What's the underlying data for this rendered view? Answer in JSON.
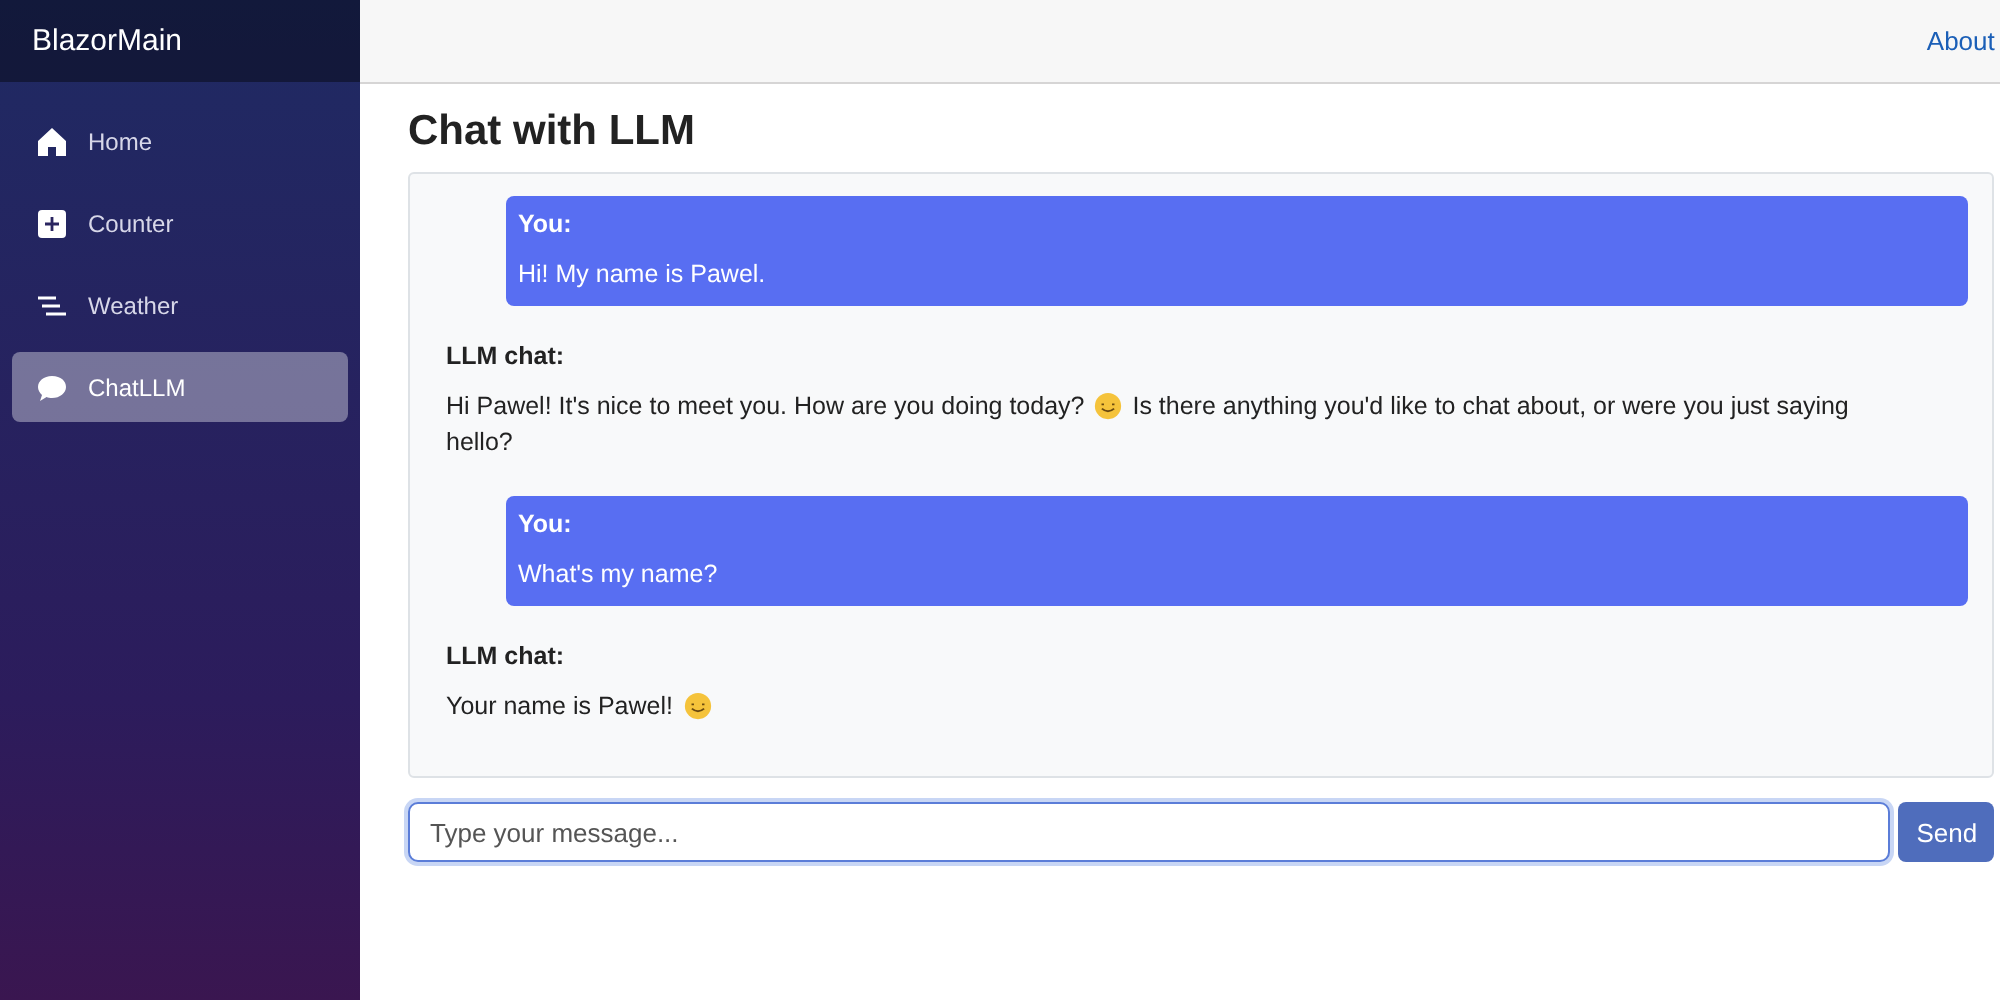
{
  "brand": "BlazorMain",
  "nav": [
    {
      "label": "Home",
      "kind": "home",
      "selected": false
    },
    {
      "label": "Counter",
      "kind": "plus",
      "selected": false
    },
    {
      "label": "Weather",
      "kind": "lines",
      "selected": false
    },
    {
      "label": "ChatLLM",
      "kind": "chat",
      "selected": true
    }
  ],
  "top_bar": {
    "link": "About"
  },
  "title": "Chat with LLM",
  "messages": [
    {
      "kind": "user",
      "sender": "You:",
      "lines": [
        [
          {
            "kind": "text",
            "text": "Hi! My name is Pawel."
          }
        ]
      ]
    },
    {
      "kind": "bot",
      "sender": "LLM chat:",
      "lines": [
        [
          {
            "kind": "text",
            "text": "Hi Pawel! It's nice to meet you. How are you doing today?"
          },
          {
            "kind": "smiley"
          },
          {
            "kind": "text",
            "text": "Is there anything you'd like to chat about, or were you just saying"
          }
        ],
        [
          {
            "kind": "text",
            "text": "hello?"
          }
        ]
      ]
    },
    {
      "kind": "user",
      "sender": "You:",
      "lines": [
        [
          {
            "kind": "text",
            "text": "What's my name?"
          }
        ]
      ]
    },
    {
      "kind": "bot",
      "sender": "LLM chat:",
      "lines": [
        [
          {
            "kind": "text",
            "text": "Your name is Pawel!"
          },
          {
            "kind": "smiley"
          }
        ]
      ]
    }
  ],
  "composer": {
    "placeholder": "Type your message...",
    "button": "Send"
  }
}
